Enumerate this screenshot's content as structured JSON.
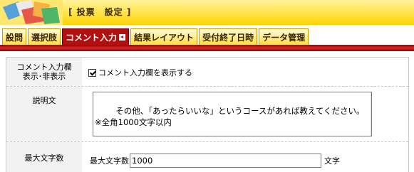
{
  "header": {
    "title": "[ 投票　設定 ]",
    "logo_icon": "voting-logo-icon"
  },
  "tabs": [
    {
      "label": "設問",
      "active": false
    },
    {
      "label": "選択肢",
      "active": false
    },
    {
      "label": "コメント入力",
      "active": true,
      "icon": "arrow-left-icon"
    },
    {
      "label": "結果レイアウト",
      "active": false
    },
    {
      "label": "受付終了日時",
      "active": false
    },
    {
      "label": "データ管理",
      "active": false
    }
  ],
  "form": {
    "comment_display": {
      "label": "コメント入力欄\n表示･非表示",
      "checkbox_label": "コメント入力欄を表示する",
      "checked": true
    },
    "description": {
      "label": "説明文",
      "value": "その他、「あったらいいな」というコースがあれば教えてください。\n※全角1000文字以内"
    },
    "max_chars": {
      "label": "最大文字数",
      "prefix": "最大文字数",
      "value": "1000",
      "suffix": "文字"
    }
  },
  "colors": {
    "header_yellow": "#ffd400",
    "active_tab_red": "#b01010",
    "label_gray": "#f2f2f2"
  }
}
